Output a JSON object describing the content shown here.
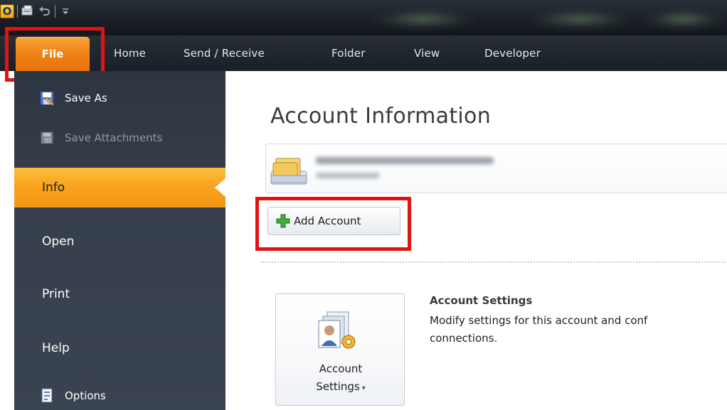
{
  "ribbon": {
    "app_icon_letter": "O",
    "tabs": [
      {
        "label": "File",
        "active": true
      },
      {
        "label": "Home"
      },
      {
        "label": "Send / Receive"
      },
      {
        "label": "Folder"
      },
      {
        "label": "View"
      },
      {
        "label": "Developer"
      }
    ],
    "qat_icons": [
      "outlook-app-icon",
      "send-receive-all-icon",
      "undo-icon",
      "customize-qat-icon"
    ]
  },
  "backstage_nav": {
    "commands_top": [
      {
        "label": "Save As",
        "icon": "save-as-icon",
        "enabled": true
      },
      {
        "label": "Save Attachments",
        "icon": "save-attachments-icon",
        "enabled": false
      }
    ],
    "tabs": [
      {
        "label": "Info",
        "active": true
      },
      {
        "label": "Open"
      },
      {
        "label": "Print"
      },
      {
        "label": "Help"
      }
    ],
    "commands_bottom": [
      {
        "label": "Options",
        "icon": "options-icon",
        "enabled": true
      }
    ]
  },
  "main": {
    "title": "Account Information",
    "account_selector": {
      "icon": "account-folder-icon",
      "email_redacted": true
    },
    "add_account_label": "Add Account",
    "account_settings": {
      "button_label_line1": "Account",
      "button_label_line2": "Settings",
      "heading": "Account Settings",
      "description_line1": "Modify settings for this account and conf",
      "description_line2": "connections."
    }
  },
  "annotations": {
    "highlight_color": "#e21313",
    "highlighted": [
      "File tab",
      "Add Account button"
    ]
  },
  "colors": {
    "ribbon_dark": "#1c2128",
    "file_tab_orange": "#f08417",
    "nav_background": "#363f4b",
    "active_nav_orange": "#f9a41f"
  }
}
